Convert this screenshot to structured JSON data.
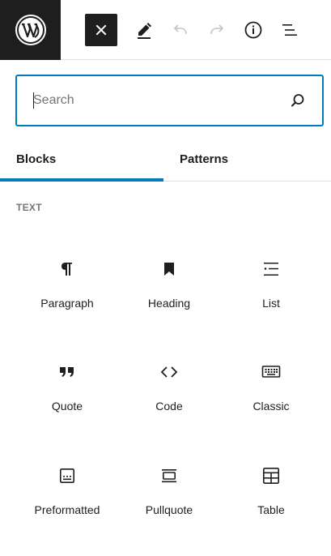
{
  "toolbar": {
    "logo_icon": "wordpress-logo-icon",
    "buttons": [
      {
        "name": "close",
        "icon": "close-icon"
      },
      {
        "name": "edit",
        "icon": "pencil-icon"
      },
      {
        "name": "undo",
        "icon": "undo-icon"
      },
      {
        "name": "redo",
        "icon": "redo-icon"
      },
      {
        "name": "details",
        "icon": "info-icon"
      },
      {
        "name": "document-overview",
        "icon": "list-view-icon"
      }
    ]
  },
  "search": {
    "placeholder": "Search",
    "value": "",
    "icon": "search-icon"
  },
  "tabs": [
    {
      "label": "Blocks",
      "active": true
    },
    {
      "label": "Patterns",
      "active": false
    }
  ],
  "category": {
    "label": "TEXT"
  },
  "blocks": [
    {
      "label": "Paragraph",
      "icon": "paragraph-icon"
    },
    {
      "label": "Heading",
      "icon": "heading-bookmark-icon"
    },
    {
      "label": "List",
      "icon": "list-icon"
    },
    {
      "label": "Quote",
      "icon": "quote-icon"
    },
    {
      "label": "Code",
      "icon": "code-icon"
    },
    {
      "label": "Classic",
      "icon": "keyboard-icon"
    },
    {
      "label": "Preformatted",
      "icon": "preformatted-icon"
    },
    {
      "label": "Pullquote",
      "icon": "pullquote-icon"
    },
    {
      "label": "Table",
      "icon": "table-icon"
    }
  ],
  "colors": {
    "accent": "#007cba",
    "dark": "#1e1e1e",
    "muted": "#757575",
    "disabled": "#a7aaad"
  }
}
